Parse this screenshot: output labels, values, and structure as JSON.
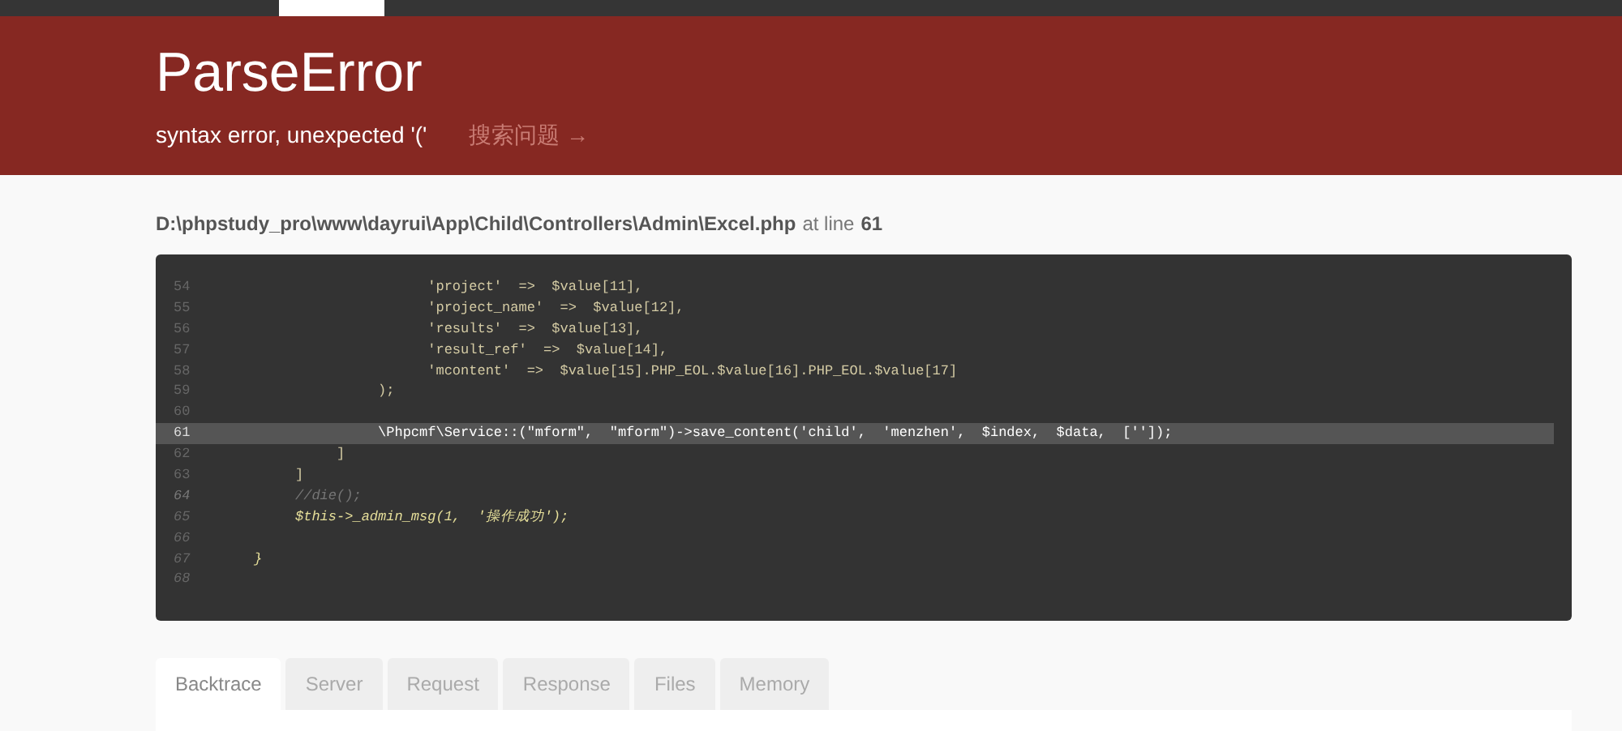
{
  "error": {
    "title": "ParseError",
    "message": "syntax error, unexpected '('",
    "search_link": "搜索问题 →"
  },
  "location": {
    "file": "D:\\phpstudy_pro\\www\\dayrui\\App\\Child\\Controllers\\Admin\\Excel.php",
    "at": "at line",
    "line": "61"
  },
  "code": [
    {
      "number": "54",
      "text": "                          'project'  =>  $value[11],",
      "kind": "code",
      "highlighted": false
    },
    {
      "number": "55",
      "text": "                          'project_name'  =>  $value[12],",
      "kind": "code",
      "highlighted": false
    },
    {
      "number": "56",
      "text": "                          'results'  =>  $value[13],",
      "kind": "code",
      "highlighted": false
    },
    {
      "number": "57",
      "text": "                          'result_ref'  =>  $value[14],",
      "kind": "code",
      "highlighted": false
    },
    {
      "number": "58",
      "text": "                          'mcontent'  =>  $value[15].PHP_EOL.$value[16].PHP_EOL.$value[17]",
      "kind": "code",
      "highlighted": false
    },
    {
      "number": "59",
      "text": "                    );",
      "kind": "code",
      "highlighted": false
    },
    {
      "number": "60",
      "kind": "code",
      "highlighted": false
    },
    {
      "number": "61",
      "text": "                    \\Phpcmf\\Service::(\"mform\",  \"mform\")->save_content('child',  'menzhen',  $index,  $data,  ['']);",
      "kind": "code",
      "highlighted": true
    },
    {
      "number": "62",
      "text": "               ]",
      "kind": "code",
      "highlighted": false
    },
    {
      "number": "63",
      "text": "          ]",
      "kind": "code",
      "highlighted": false
    },
    {
      "number": "64",
      "text": "          //die();",
      "kind": "comment",
      "highlighted": false
    },
    {
      "number": "65",
      "text": "          $this->_admin_msg(1,  '操作成功');",
      "kind": "italic",
      "highlighted": false
    },
    {
      "number": "66",
      "kind": "italic",
      "highlighted": false
    },
    {
      "number": "67",
      "text": "     }",
      "kind": "italic",
      "highlighted": false
    },
    {
      "number": "68",
      "kind": "italic",
      "highlighted": false
    }
  ],
  "tabs": [
    {
      "label": "Backtrace",
      "selected": true
    },
    {
      "label": "Server",
      "selected": false
    },
    {
      "label": "Request",
      "selected": false
    },
    {
      "label": "Response",
      "selected": false
    },
    {
      "label": "Files",
      "selected": false
    },
    {
      "label": "Memory",
      "selected": false
    }
  ]
}
